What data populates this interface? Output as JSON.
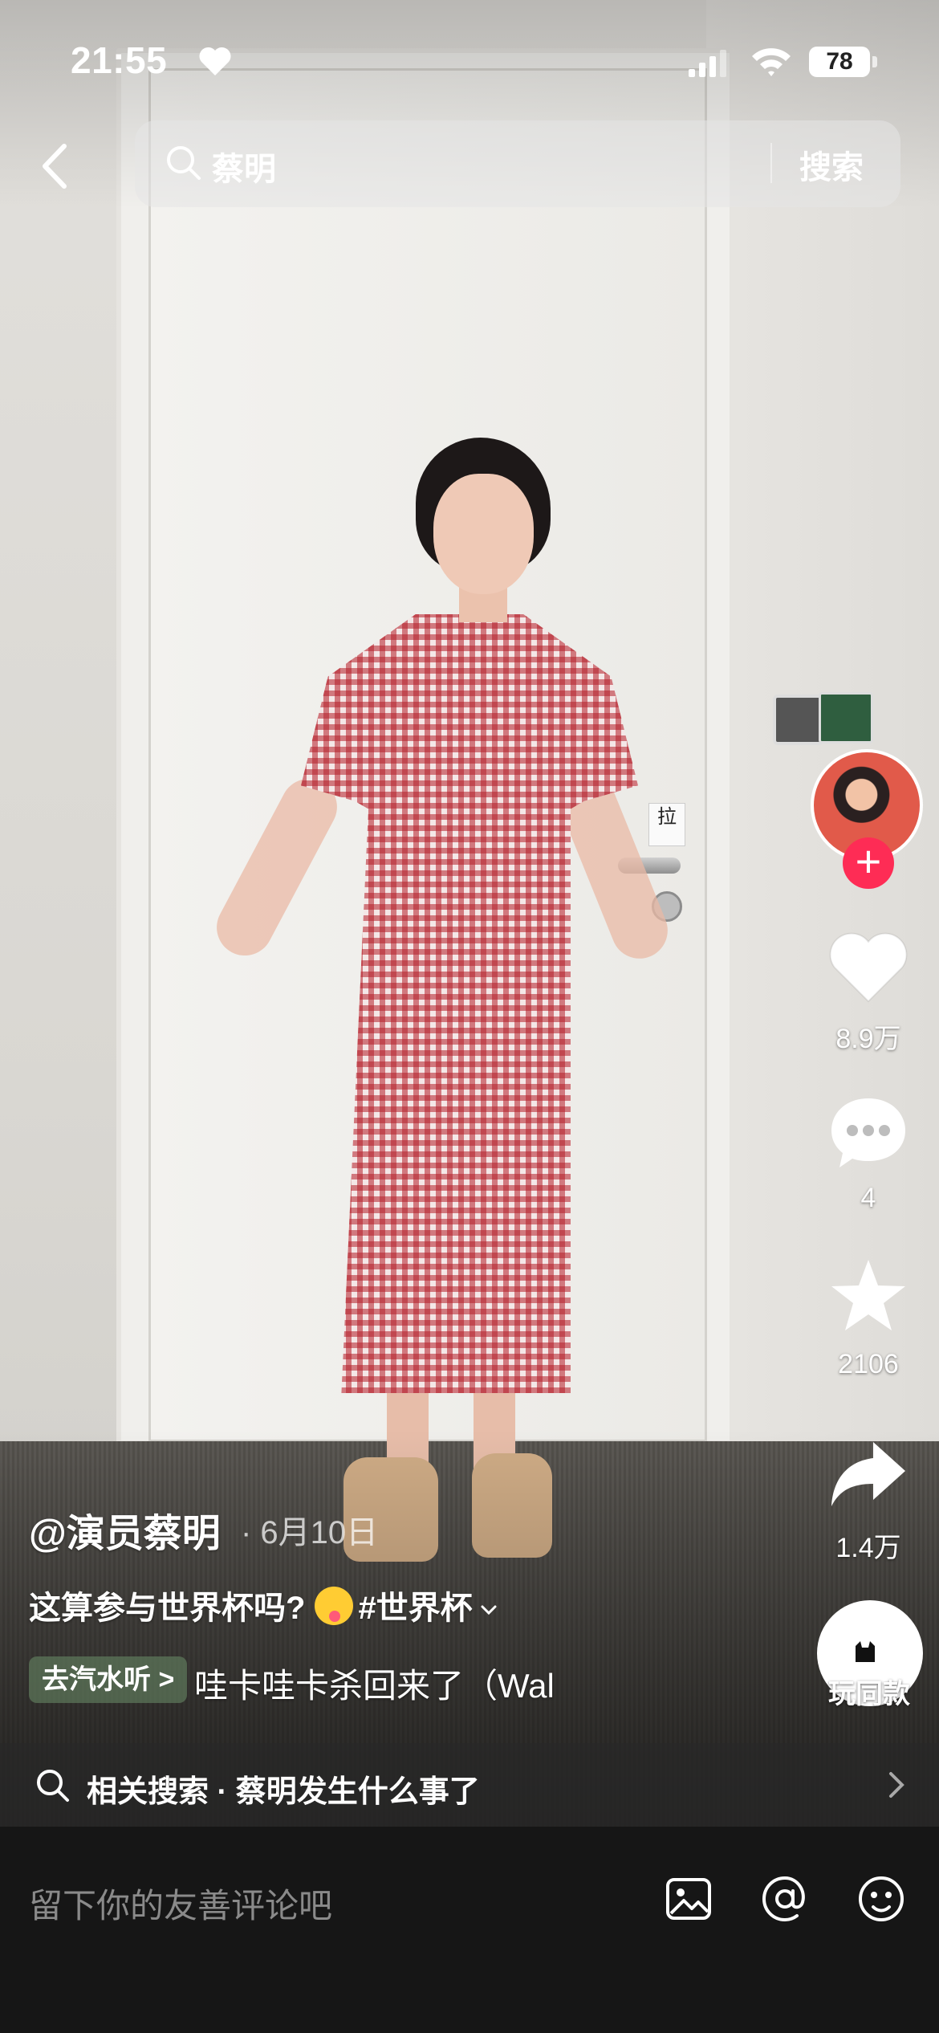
{
  "status_bar": {
    "time": "21:55",
    "battery": "78"
  },
  "search": {
    "query": "蔡明",
    "button_label": "搜索"
  },
  "sidebar": {
    "likes": "8.9万",
    "comments": "4",
    "favorites": "2106",
    "shares": "1.4万",
    "remix_label": "玩同款"
  },
  "post": {
    "author": "@演员蔡明",
    "date": "· 6月10日",
    "caption_text": "这算参与世界杯吗?",
    "hashtag": "#世界杯",
    "music_chip": "去汽水听 >",
    "music_title": "哇卡哇卡杀回来了（Wal"
  },
  "related": {
    "text": "相关搜索 · 蔡明发生什么事了"
  },
  "comment": {
    "placeholder": "留下你的友善评论吧"
  },
  "colors": {
    "follow_accent": "#fe2c55",
    "comment_bar_bg": "#161616"
  }
}
